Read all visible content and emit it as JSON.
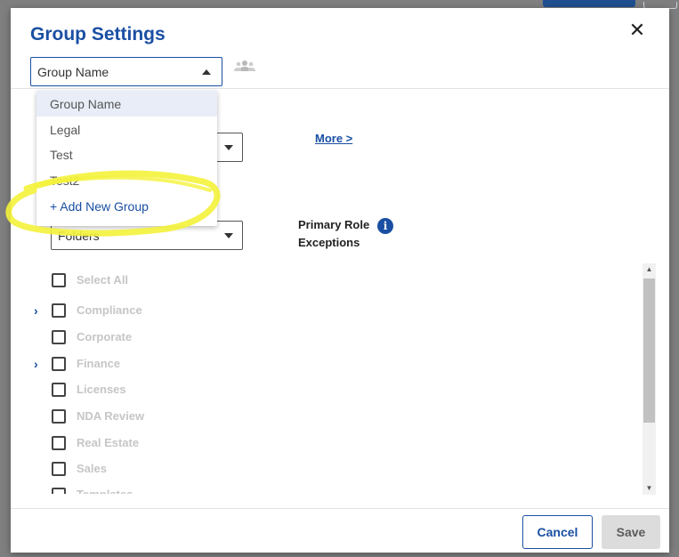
{
  "modal": {
    "title": "Group Settings",
    "close_glyph": "✕",
    "group_select_value": "Group Name"
  },
  "dropdown": {
    "options": [
      "Group Name",
      "Legal",
      "Test",
      "Test2"
    ],
    "add_label": "+ Add New Group",
    "selected_index": 0
  },
  "permissions": {
    "more_link": "More >",
    "folders_select_value": "Folders",
    "primary_role_line1": "Primary Role",
    "primary_role_line2": "Exceptions",
    "info_glyph": "i"
  },
  "folders": {
    "select_all": "Select All",
    "items": [
      {
        "label": "Compliance",
        "expandable": true
      },
      {
        "label": "Corporate",
        "expandable": false
      },
      {
        "label": "Finance",
        "expandable": true
      },
      {
        "label": "Licenses",
        "expandable": false
      },
      {
        "label": "NDA Review",
        "expandable": false
      },
      {
        "label": "Real Estate",
        "expandable": false
      },
      {
        "label": "Sales",
        "expandable": false
      },
      {
        "label": "Templates",
        "expandable": false
      }
    ]
  },
  "footer": {
    "cancel_label": "Cancel",
    "save_label": "Save"
  },
  "icons": {
    "close": "close-icon",
    "group": "group-icon",
    "caret": "caret-icon",
    "chevron": "chevron-right-icon",
    "info": "info-icon"
  },
  "colors": {
    "accent": "#1a4fa3",
    "highlight": "#f4f23a",
    "disabled_text": "#c6c6c6"
  }
}
